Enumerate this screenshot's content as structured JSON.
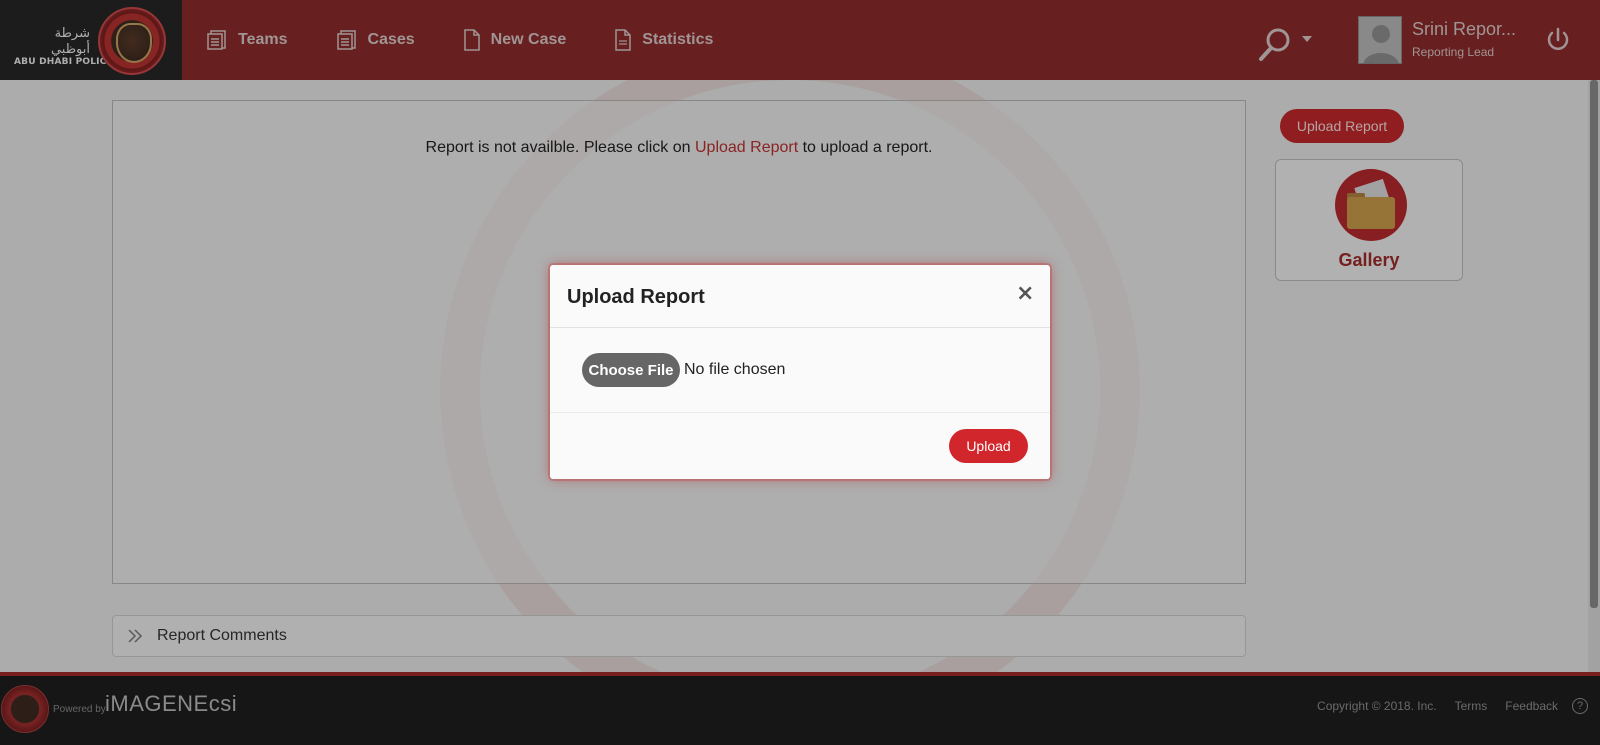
{
  "header": {
    "logo_arabic": "شرطة أبوظبي",
    "logo_english": "ABU DHABI POLICE",
    "nav": [
      {
        "label": "Teams",
        "icon": "list-document-icon"
      },
      {
        "label": "Cases",
        "icon": "list-document-icon"
      },
      {
        "label": "New Case",
        "icon": "document-icon"
      },
      {
        "label": "Statistics",
        "icon": "document-icon"
      }
    ],
    "search_icon": "search-icon",
    "user": {
      "name": "Srini Repor...",
      "role": "Reporting Lead"
    }
  },
  "main": {
    "message_before": "Report is not availble. Please click on ",
    "message_link": "Upload Report",
    "message_after": " to upload a report.",
    "comments_label": "Report Comments",
    "side_upload_label": "Upload Report",
    "gallery_label": "Gallery"
  },
  "modal": {
    "title": "Upload Report",
    "close_symbol": "×",
    "choose_file_label": "Choose File",
    "no_file_text": "No file chosen",
    "upload_label": "Upload"
  },
  "footer": {
    "powered_by": "Powered by",
    "brand": "iMAGENEcsi",
    "copyright": "Copyright © 2018. Inc.",
    "terms": "Terms",
    "feedback": "Feedback",
    "help_symbol": "?"
  },
  "colors": {
    "header": "#8b2a2a",
    "accent": "#d1262b",
    "footer": "#1e1e1e"
  }
}
